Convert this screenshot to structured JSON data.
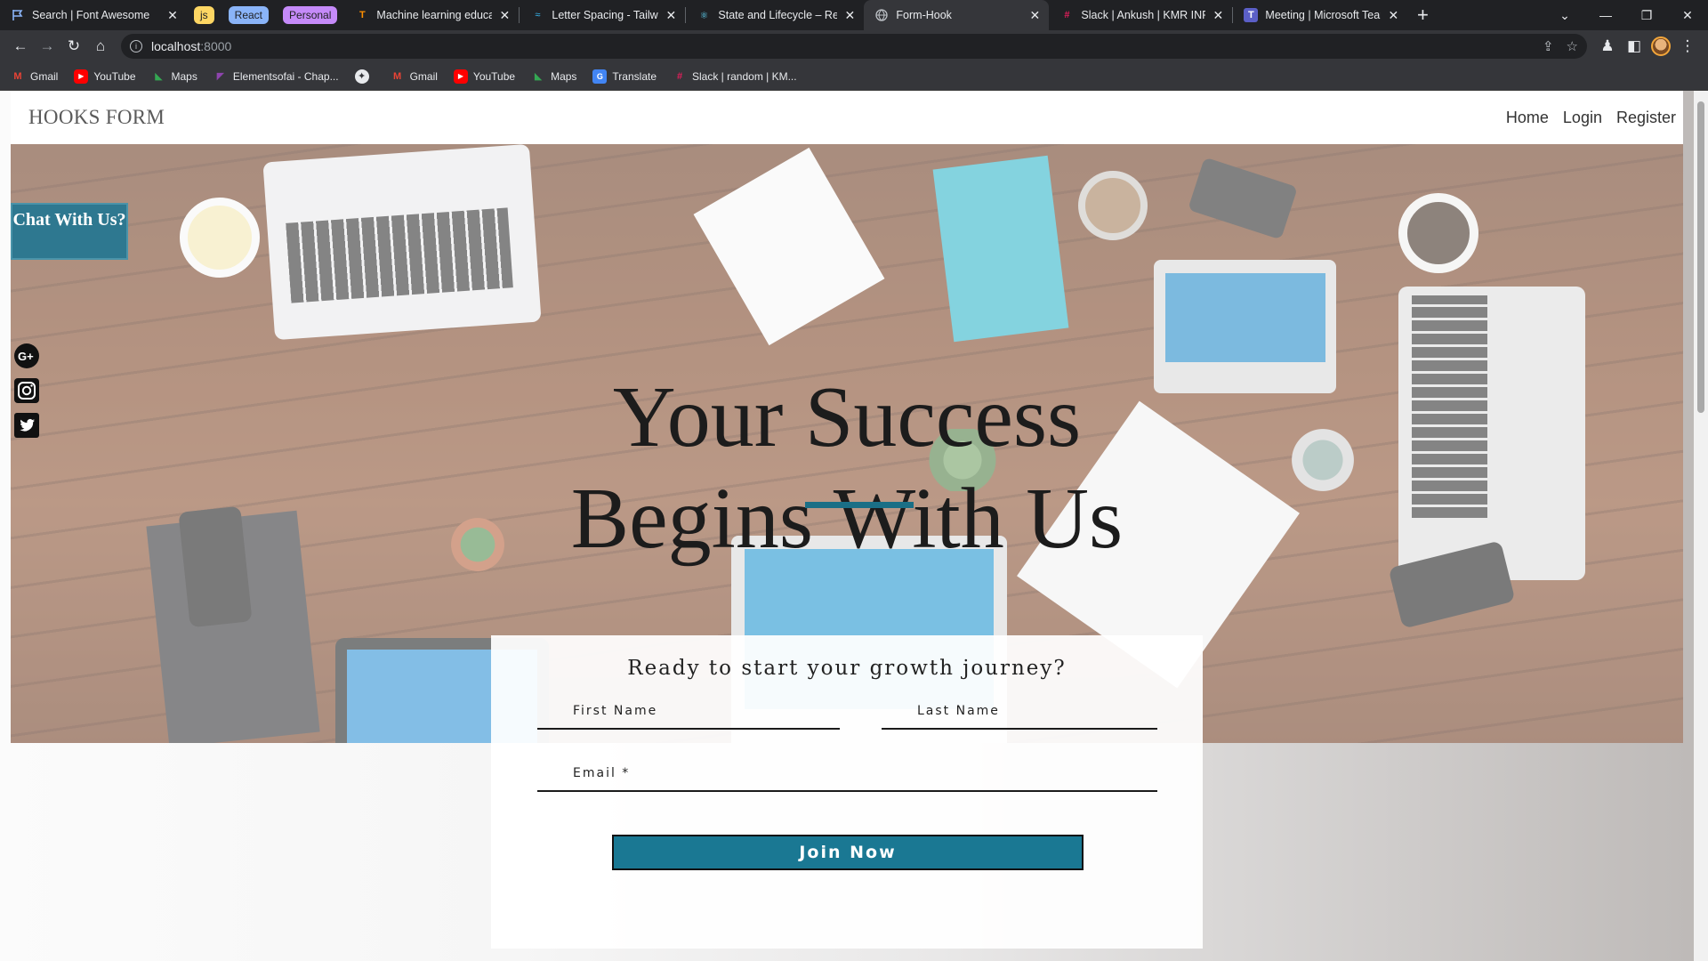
{
  "browser": {
    "tabs": [
      {
        "title": "Search | Font Awesome",
        "icon": "flag-icon"
      },
      {
        "title": "Machine learning educatio",
        "icon": "tensorflow-icon"
      },
      {
        "title": "Letter Spacing - Tailwind C",
        "icon": "tailwind-icon"
      },
      {
        "title": "State and Lifecycle – React",
        "icon": "react-icon"
      },
      {
        "title": "Form-Hook",
        "icon": "globe-icon"
      },
      {
        "title": "Slack | Ankush | KMR INFO",
        "icon": "slack-icon"
      },
      {
        "title": "Meeting | Microsoft Teams",
        "icon": "teams-icon"
      }
    ],
    "tab_groups": [
      {
        "label": "js",
        "color": "#fdd663"
      },
      {
        "label": "React",
        "color": "#8ab4f8"
      },
      {
        "label": "Personal",
        "color": "#c58af9"
      }
    ],
    "url_host": "localhost",
    "url_port": ":8000",
    "bookmarks": [
      {
        "label": "Gmail",
        "icon": "gmail-icon"
      },
      {
        "label": "YouTube",
        "icon": "youtube-icon"
      },
      {
        "label": "Maps",
        "icon": "maps-icon"
      },
      {
        "label": "Elementsofai - Chap...",
        "icon": "elementsofai-icon"
      },
      {
        "label": "",
        "icon": "globe-icon"
      },
      {
        "label": "Gmail",
        "icon": "gmail-icon"
      },
      {
        "label": "YouTube",
        "icon": "youtube-icon"
      },
      {
        "label": "Maps",
        "icon": "maps-icon"
      },
      {
        "label": "Translate",
        "icon": "translate-icon"
      },
      {
        "label": "Slack | random | KM...",
        "icon": "slack-icon"
      }
    ]
  },
  "navbar": {
    "brand": "HOOKS FORM",
    "links": [
      "Home",
      "Login",
      "Register"
    ]
  },
  "hero": {
    "title_line1": "Your Success",
    "title_line2": "Begins With Us"
  },
  "chat": {
    "label": "Chat With Us?"
  },
  "social": [
    "google-plus-icon",
    "instagram-icon",
    "twitter-icon"
  ],
  "form": {
    "heading": "Ready to start your growth journey?",
    "first_name_placeholder": "First Name",
    "last_name_placeholder": "Last Name",
    "email_placeholder": "Email *",
    "submit_label": "Join Now"
  },
  "colors": {
    "accent": "#1a7893",
    "chat_bg": "#2e7890"
  }
}
